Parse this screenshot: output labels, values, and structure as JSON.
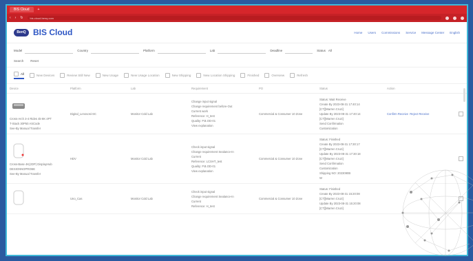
{
  "browser": {
    "tab_title": "BIS Cloud",
    "url": "bis.cloud.benq.com"
  },
  "app": {
    "logo_text": "BenQ",
    "title": "BIS Cloud"
  },
  "topnav": [
    "Home",
    "Users",
    "Commissions",
    "Service",
    "Message Center",
    "English"
  ],
  "filters": {
    "model_label": "Model",
    "country_label": "Country",
    "platform_label": "Platform",
    "lab_label": "Lab",
    "deadline_label": "Deadline",
    "status_label": "Status",
    "status_value": "All"
  },
  "actions": {
    "search": "Search",
    "reset": "Reset"
  },
  "toolbar": [
    "All",
    "New Devices",
    "Review Still New",
    "New Usage",
    "New Usage Location",
    "New Shipping",
    "New Location Shipping",
    "Finished",
    "Overview",
    "Refresh"
  ],
  "columns": [
    "Device",
    "Platform",
    "Lab",
    "Requirement",
    "PO",
    "Status",
    "Action"
  ],
  "rows": [
    {
      "device": "Cross-Arch 3-4 Rides 4k-8K 4PT\nT-Stack 30P50 ASCode\nSee-By Manual Transfer",
      "platform": "Digital_Lenovosi-SC",
      "lab": "Monitor Cold Lab",
      "requirement": "Change input signal\nChange requirement before-Out\nCurrent work\nReference: H_test\nQuality: P.B.OD-01\nView explanation",
      "po": "Commercial & Consumer 10 Zone",
      "status": "Status: Wait Receive\nCreate By 2023-08-31 17:40:14\n[CT][Warren Cruzi]\nUpdate By 2023-08-31 17:40:14\n[CT][Warren Cruzi]\nSend Confirmation\nCustomization",
      "action1": "Confirm Receive",
      "action2": "Reject Receive"
    },
    {
      "device": "Cross-Base 4K(2DP) DisplayHub\nDESIGNNOPROBE\nSee-By Manual Transfer",
      "platform": "HDV",
      "lab": "Monitor Cold Lab",
      "requirement": "Check input signal\nChange requirement Sealance-In\nCurrent\nReference: LCSHT_test\nQuality: P.B.OD-01\nView explanation",
      "po": "Commercial & Consumer 10 Zone",
      "status": "Status: Finished\nCreate By 2023-08-31 17:30:17\n[CT][Warren Cruzi]\nUpdate By 2023-08-31 17:30:18\n[CT][Warren Cruzi]\nSend Confirmation\nCustomization\nShipping NO: 2023090B\nW",
      "action1": "",
      "action2": ""
    },
    {
      "device": "",
      "platform": "Uno_Cas",
      "lab": "Monitor Cold Lab",
      "requirement": "Check input signal\nChange requirement Sealance-In\nCurrent\nReference: H_test",
      "po": "Commercial & Consumer 10 Zone",
      "status": "Status: Finished\nCreate By 2023-08-31 15:20:08\n[CT][Warren Cruzi]\nUpdate By 2023-08-31 15:20:08\n[CT][Warren Cruzi]",
      "action1": "",
      "action2": ""
    }
  ]
}
